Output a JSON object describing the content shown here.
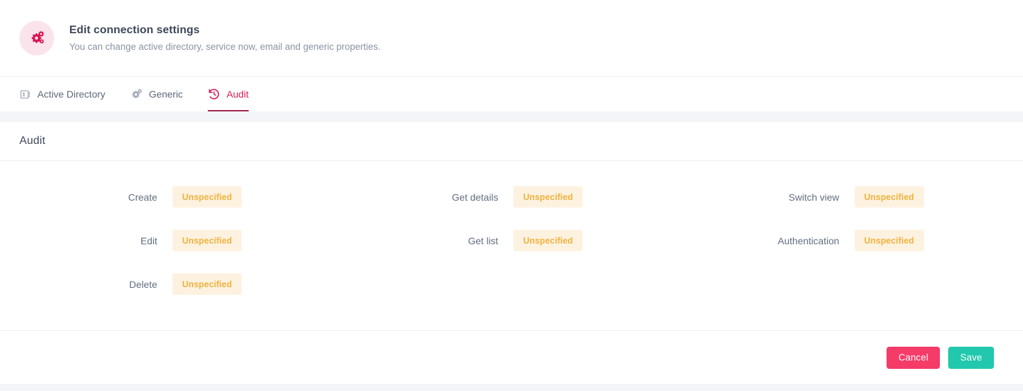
{
  "header": {
    "icon": "gears-icon",
    "title": "Edit connection settings",
    "subtitle": "You can change active directory, service now, email and generic properties."
  },
  "tabs": [
    {
      "label": "Active Directory",
      "icon": "id-card-icon",
      "active": false
    },
    {
      "label": "Generic",
      "icon": "gears-icon",
      "active": false
    },
    {
      "label": "Audit",
      "icon": "history-icon",
      "active": true
    }
  ],
  "audit": {
    "card_title": "Audit",
    "columns": [
      {
        "fields": [
          {
            "label": "Create",
            "value": "Unspecified"
          },
          {
            "label": "Edit",
            "value": "Unspecified"
          },
          {
            "label": "Delete",
            "value": "Unspecified"
          }
        ]
      },
      {
        "fields": [
          {
            "label": "Get details",
            "value": "Unspecified"
          },
          {
            "label": "Get list",
            "value": "Unspecified"
          }
        ]
      },
      {
        "fields": [
          {
            "label": "Switch view",
            "value": "Unspecified"
          },
          {
            "label": "Authentication",
            "value": "Unspecified"
          }
        ]
      }
    ]
  },
  "footer": {
    "cancel_label": "Cancel",
    "save_label": "Save"
  },
  "colors": {
    "accent_red": "#D61F52",
    "accent_underline": "#A2234E",
    "badge_bg": "#FDF2E0",
    "badge_text": "#F0B23E",
    "cancel_bg": "#F53B68",
    "save_bg": "#21C8AD",
    "page_bg": "#F4F5F9"
  }
}
